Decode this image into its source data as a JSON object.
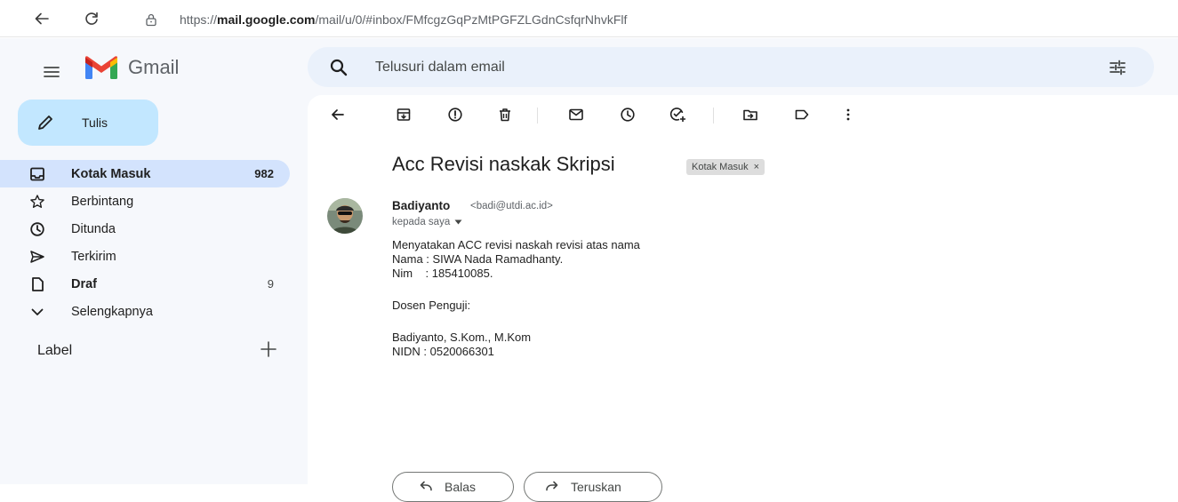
{
  "browser": {
    "url_prefix": "https://",
    "url_domain": "mail.google.com",
    "url_path": "/mail/u/0/#inbox/FMfcgzGqPzMtPGFZLGdnCsfqrNhvkFlf",
    "back_icon": "arrow-left-icon",
    "reload_icon": "reload-icon",
    "lock_icon": "lock-icon"
  },
  "header": {
    "app_name": "Gmail",
    "search_placeholder": "Telusuri dalam email"
  },
  "sidebar": {
    "compose_label": "Tulis",
    "items": [
      {
        "label": "Kotak Masuk",
        "count": "982",
        "icon": "inbox-icon",
        "active": true
      },
      {
        "label": "Berbintang",
        "count": "",
        "icon": "star-icon"
      },
      {
        "label": "Ditunda",
        "count": "",
        "icon": "clock-icon"
      },
      {
        "label": "Terkirim",
        "count": "",
        "icon": "send-icon"
      },
      {
        "label": "Draf",
        "count": "9",
        "icon": "draft-icon"
      },
      {
        "label": "Selengkapnya",
        "count": "",
        "icon": "chevron-down-icon"
      }
    ],
    "labels_heading": "Label"
  },
  "email": {
    "subject": "Acc Revisi naskak Skripsi",
    "tag": "Kotak Masuk",
    "tag_close": "×",
    "sender_name": "Badiyanto",
    "sender_email": "<badi@utdi.ac.id>",
    "recipient": "kepada saya",
    "body": {
      "line1": "Menyatakan ACC revisi naskah revisi atas nama",
      "line2": "Nama : SIWA Nada Ramadhanty.",
      "line3": "Nim    : 185410085.",
      "line4": "Dosen Penguji:",
      "line5": "Badiyanto, S.Kom., M.Kom",
      "line6": "NIDN : 0520066301"
    }
  },
  "actions": {
    "reply_label": "Balas",
    "forward_label": "Teruskan"
  },
  "colors": {
    "accent": "#c2e7ff",
    "active_nav": "#d3e3fd",
    "background": "#f6f8fc",
    "search_bg": "#eaf1fb"
  }
}
